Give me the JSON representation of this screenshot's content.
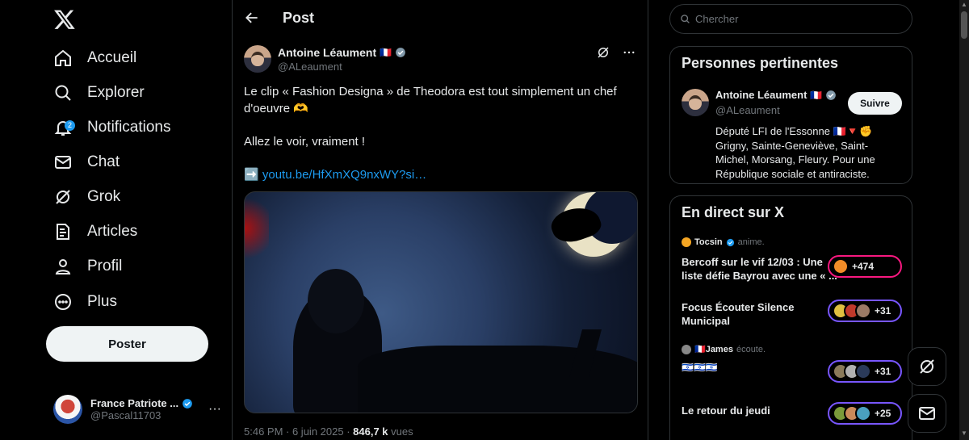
{
  "nav": {
    "items": [
      {
        "label": "Accueil",
        "icon": "home-icon"
      },
      {
        "label": "Explorer",
        "icon": "search-icon"
      },
      {
        "label": "Notifications",
        "icon": "bell-icon",
        "badge": "2"
      },
      {
        "label": "Chat",
        "icon": "mail-icon"
      },
      {
        "label": "Grok",
        "icon": "grok-icon"
      },
      {
        "label": "Articles",
        "icon": "article-icon"
      },
      {
        "label": "Profil",
        "icon": "person-icon"
      },
      {
        "label": "Plus",
        "icon": "more-circle-icon"
      }
    ],
    "post_button": "Poster",
    "account": {
      "name": "France Patriote ...",
      "handle": "@Pascal11703"
    }
  },
  "main": {
    "header_title": "Post",
    "author": {
      "name": "Antoine Léaument",
      "flag": "🇫🇷",
      "handle": "@ALeaument"
    },
    "text_line1": "Le clip « Fashion Designa » de Theodora est tout simplement un chef d'oeuvre 🫶",
    "text_line2": "Allez le voir, vraiment !",
    "link_prefix": "➡️",
    "link_text": "youtu.be/HfXmXQ9nxWY?si…",
    "meta_time": "5:46 PM · 6 juin 2025 · ",
    "meta_views": "846,7 k",
    "meta_views_label": " vues"
  },
  "right": {
    "search_placeholder": "Chercher",
    "relevant": {
      "title": "Personnes pertinentes",
      "name": "Antoine Léaument",
      "flag": "🇫🇷",
      "handle": "@ALeaument",
      "follow_label": "Suivre",
      "bio": "Député LFI de l'Essonne 🇫🇷🔻✊ Grigny, Sainte-Geneviève, Saint-Michel, Morsang, Fleury. Pour une République sociale et antiraciste."
    },
    "live": {
      "title": "En direct sur X",
      "spaces": [
        {
          "host": "Tocsin",
          "host_action": "anime.",
          "title": "Bercoff sur le vif 12/03 : Une liste défie Bayrou avec une « ...",
          "count": "+474"
        },
        {
          "host": "",
          "host_action": "",
          "title": "Focus Écouter Silence Municipal",
          "count": "+31"
        },
        {
          "host": "🇫🇷James",
          "host_action": "écoute.",
          "title": "🇮🇱🇮🇱🇮🇱",
          "count": "+31"
        },
        {
          "host": "",
          "host_action": "",
          "title": "Le retour du jeudi",
          "count": "+25"
        }
      ]
    }
  },
  "colors": {
    "accent": "#1d9bf0",
    "background": "#000000",
    "border": "#2f3336",
    "muted": "#71767b",
    "space_purple": "#7856ff",
    "space_pink": "#f91880"
  }
}
